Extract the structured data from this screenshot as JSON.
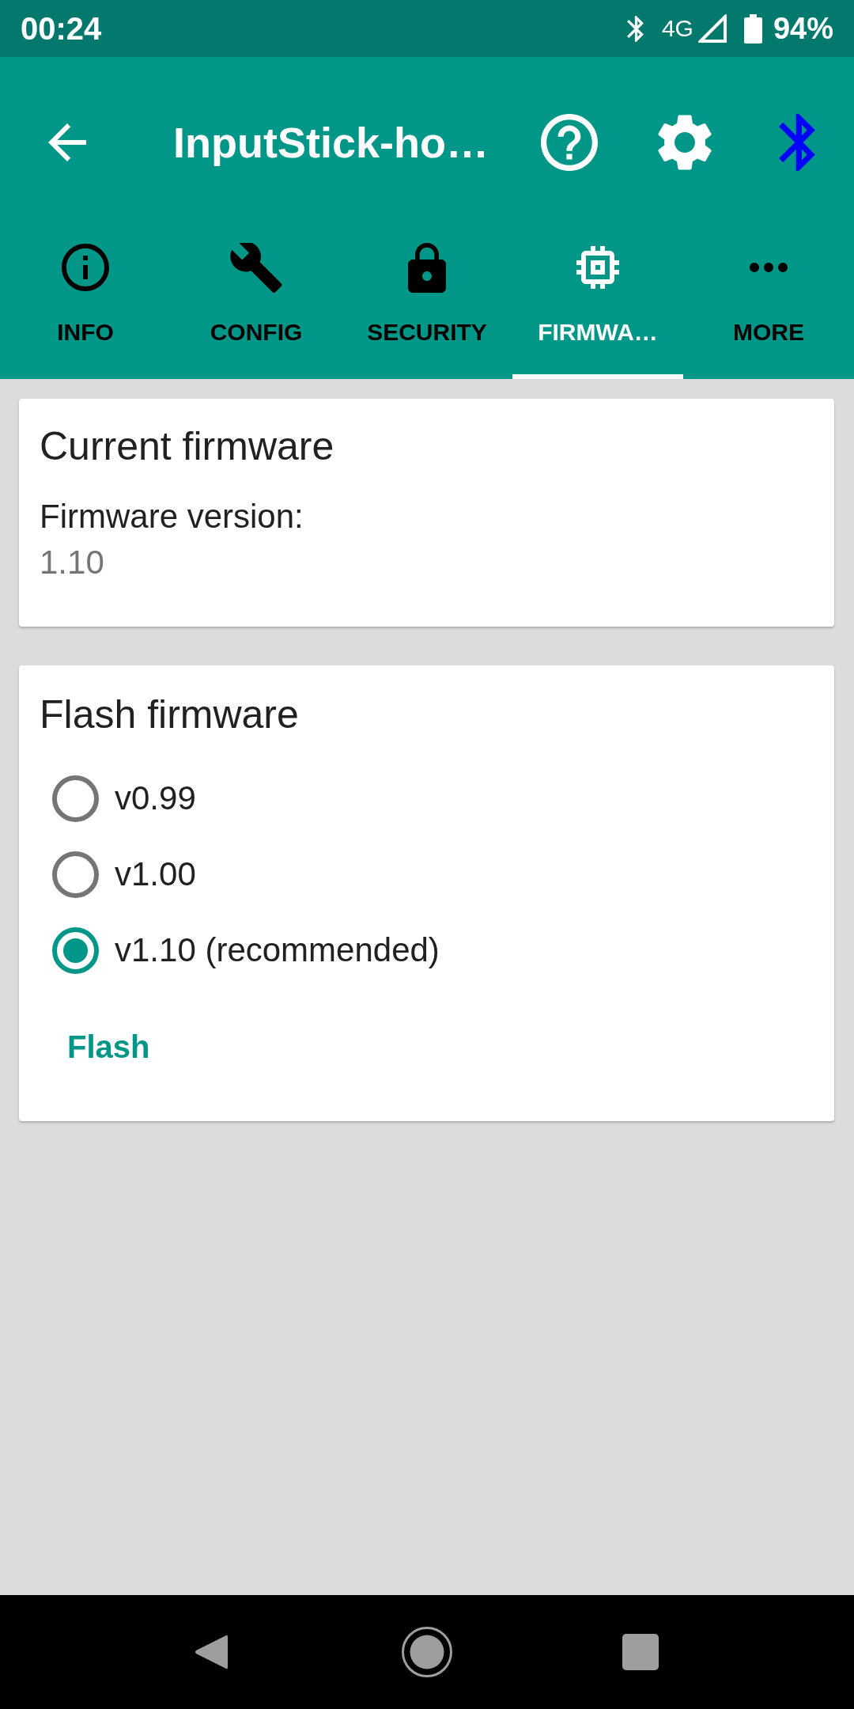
{
  "status_bar": {
    "time": "00:24",
    "network": "4G",
    "battery": "94%"
  },
  "toolbar": {
    "title": "InputStick-ho…"
  },
  "tabs": [
    {
      "label": "INFO",
      "selected": false
    },
    {
      "label": "CONFIG",
      "selected": false
    },
    {
      "label": "SECURITY",
      "selected": false
    },
    {
      "label": "FIRMWA…",
      "selected": true
    },
    {
      "label": "MORE",
      "selected": false
    }
  ],
  "current_firmware": {
    "title": "Current firmware",
    "label": "Firmware version:",
    "value": "1.10"
  },
  "flash_firmware": {
    "title": "Flash firmware",
    "options": [
      {
        "label": "v0.99",
        "selected": false
      },
      {
        "label": "v1.00",
        "selected": false
      },
      {
        "label": "v1.10 (recommended)",
        "selected": true
      }
    ],
    "button": "Flash"
  }
}
